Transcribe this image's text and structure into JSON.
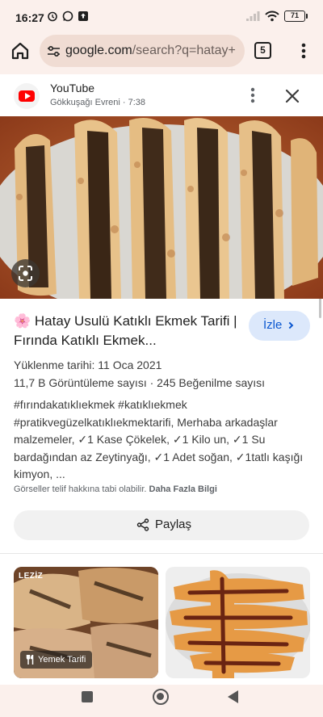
{
  "status_bar": {
    "time": "16:27",
    "battery": "71"
  },
  "browser": {
    "url_host": "google.com",
    "url_path": "/search?q=hatay+",
    "tab_count": "5"
  },
  "result": {
    "source_name": "YouTube",
    "source_meta": "Gökkuşağı Evreni · 7:38",
    "title_emoji": "🌸",
    "title": "Hatay Usulü Katıklı Ekmek Tarifi | Fırında Katıklı Ekmek...",
    "watch_label": "İzle",
    "upload_date": "Yüklenme tarihi: 11 Oca 2021",
    "views": "11,7 B Görüntüleme sayısı",
    "likes": "245 Beğenilme sayısı",
    "description": "#fırındakatıklıekmek #katıklıekmek #pratikvegüzelkatıklıekmektarifi, Merhaba arkadaşlar malzemeler, ✓1 Kase Çökelek, ✓1 Kilo un, ✓1 Su bardağından az Zeytinyağı, ✓1 Adet soğan, ✓1tatlı kaşığı kimyon, ...",
    "copyright": "Görseller telif hakkına tabi olabilir.",
    "more_info": "Daha Fazla Bilgi",
    "share_label": "Paylaş"
  },
  "related": [
    {
      "watermark": "LEZİZ",
      "chip": "Yemek Tarifi"
    },
    {}
  ],
  "colors": {
    "accent_blue": "#0b57d0",
    "youtube_red": "#ff0000",
    "chrome_bg": "#fbf0ec"
  }
}
